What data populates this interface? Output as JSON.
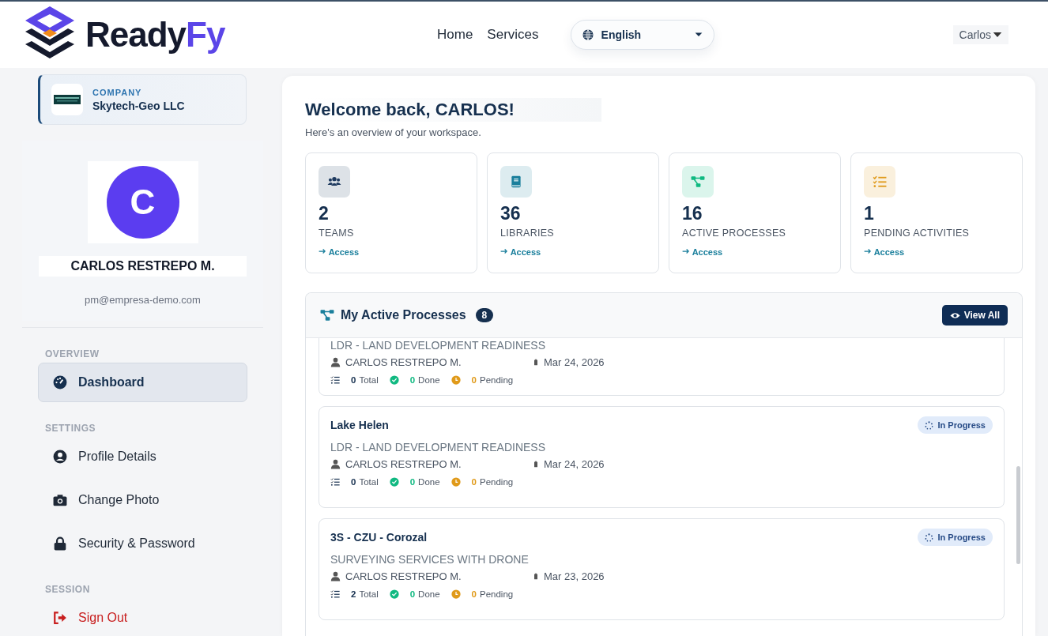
{
  "header": {
    "logo": {
      "text": "Ready",
      "accent": "Fy"
    },
    "nav": [
      "Home",
      "Services"
    ],
    "language": {
      "value": "English"
    },
    "user_menu": {
      "label": "Carlos"
    }
  },
  "sidebar": {
    "company": {
      "label": "COMPANY",
      "name": "Skytech-Geo LLC"
    },
    "profile": {
      "initial": "C",
      "name": "CARLOS RESTREPO M.",
      "email": "pm@empresa-demo.com"
    },
    "sections": [
      {
        "title": "OVERVIEW",
        "items": [
          {
            "label": "Dashboard",
            "kind": "dashboard",
            "selected": true
          }
        ]
      },
      {
        "title": "SETTINGS",
        "items": [
          {
            "label": "Profile Details",
            "kind": "profile",
            "selected": false
          },
          {
            "label": "Change Photo",
            "kind": "photo",
            "selected": false
          },
          {
            "label": "Security & Password",
            "kind": "security",
            "selected": false
          }
        ]
      },
      {
        "title": "SESSION",
        "items": [
          {
            "label": "Sign Out",
            "kind": "signout",
            "selected": false
          }
        ]
      }
    ]
  },
  "main": {
    "title": "Welcome back, CARLOS!",
    "subtitle": "Here's an overview of your workspace.",
    "stats": [
      {
        "value": "2",
        "label": "TEAMS",
        "link": "Access",
        "kind": "teams",
        "color": "#1e3a5f"
      },
      {
        "value": "36",
        "label": "LIBRARIES",
        "link": "Access",
        "kind": "libraries",
        "color": "#1a7f9c"
      },
      {
        "value": "16",
        "label": "ACTIVE PROCESSES",
        "link": "Access",
        "kind": "processes",
        "color": "#10b981"
      },
      {
        "value": "1",
        "label": "PENDING ACTIVITIES",
        "link": "Access",
        "kind": "pending",
        "color": "#e09a1a"
      }
    ],
    "processes": {
      "title": "My Active Processes",
      "count": "8",
      "view_all": "View All",
      "items": [
        {
          "category": "LDR - LAND DEVELOPMENT READINESS",
          "owner": "CARLOS RESTREPO M.",
          "date": "Mar 24, 2026",
          "stats": [
            {
              "kind": "total",
              "value": "0",
              "label": "Total"
            },
            {
              "kind": "done",
              "value": "0",
              "label": "Done"
            },
            {
              "kind": "pending",
              "value": "0",
              "label": "Pending"
            }
          ]
        },
        {
          "name": "Lake Helen",
          "status": "In Progress",
          "category": "LDR - LAND DEVELOPMENT READINESS",
          "owner": "CARLOS RESTREPO M.",
          "date": "Mar 24, 2026",
          "stats": [
            {
              "kind": "total",
              "value": "0",
              "label": "Total"
            },
            {
              "kind": "done",
              "value": "0",
              "label": "Done"
            },
            {
              "kind": "pending",
              "value": "0",
              "label": "Pending"
            }
          ]
        },
        {
          "name": "3S - CZU - Corozal",
          "status": "In Progress",
          "category": "SURVEYING SERVICES WITH DRONE",
          "owner": "CARLOS RESTREPO M.",
          "date": "Mar 23, 2026",
          "stats": [
            {
              "kind": "total",
              "value": "2",
              "label": "Total"
            },
            {
              "kind": "done",
              "value": "0",
              "label": "Done"
            },
            {
              "kind": "pending",
              "value": "0",
              "label": "Pending"
            }
          ]
        }
      ]
    }
  }
}
